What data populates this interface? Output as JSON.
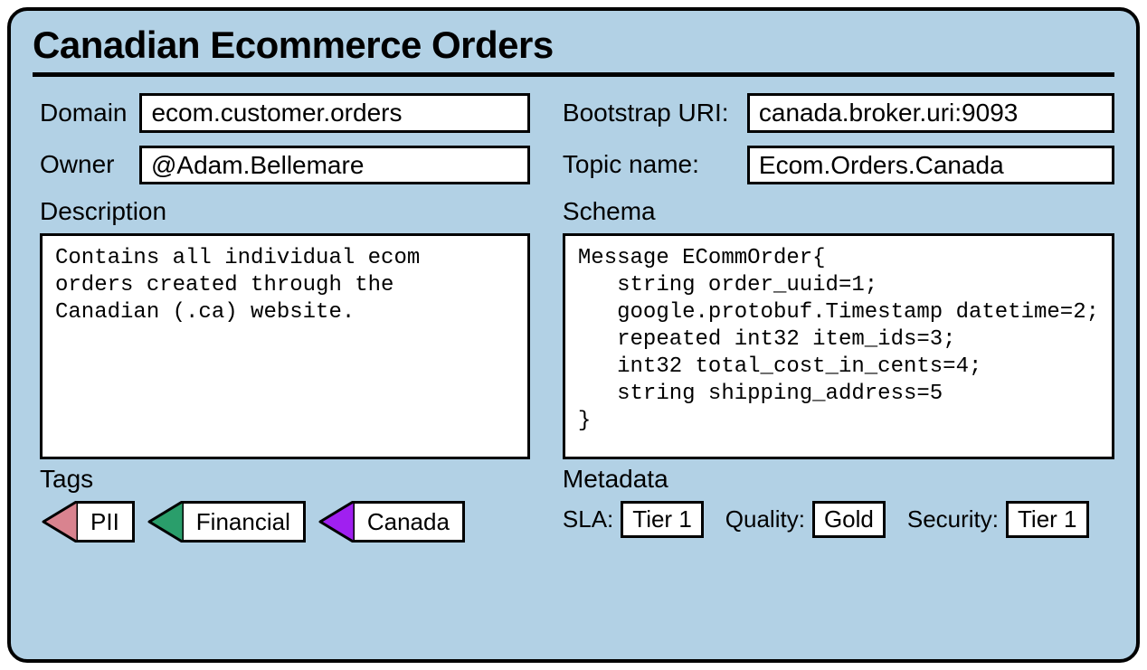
{
  "title": "Canadian Ecommerce Orders",
  "left": {
    "domain_label": "Domain",
    "domain_value": "ecom.customer.orders",
    "owner_label": "Owner",
    "owner_value": "@Adam.Bellemare",
    "description_label": "Description",
    "description_value": "Contains all individual ecom\norders created through the\nCanadian (.ca) website.",
    "tags_label": "Tags",
    "tags": [
      {
        "label": "PII",
        "color": "#d9838f"
      },
      {
        "label": "Financial",
        "color": "#2a9e6b"
      },
      {
        "label": "Canada",
        "color": "#a020f0"
      }
    ]
  },
  "right": {
    "bootstrap_label": "Bootstrap URI:",
    "bootstrap_value": "canada.broker.uri:9093",
    "topic_label": "Topic name:",
    "topic_value": "Ecom.Orders.Canada",
    "schema_label": "Schema",
    "schema_value": "Message ECommOrder{\n   string order_uuid=1;\n   google.protobuf.Timestamp datetime=2;\n   repeated int32 item_ids=3;\n   int32 total_cost_in_cents=4;\n   string shipping_address=5\n}",
    "metadata_label": "Metadata",
    "metadata": {
      "sla_label": "SLA:",
      "sla_value": "Tier 1",
      "quality_label": "Quality:",
      "quality_value": "Gold",
      "security_label": "Security:",
      "security_value": "Tier 1"
    }
  }
}
